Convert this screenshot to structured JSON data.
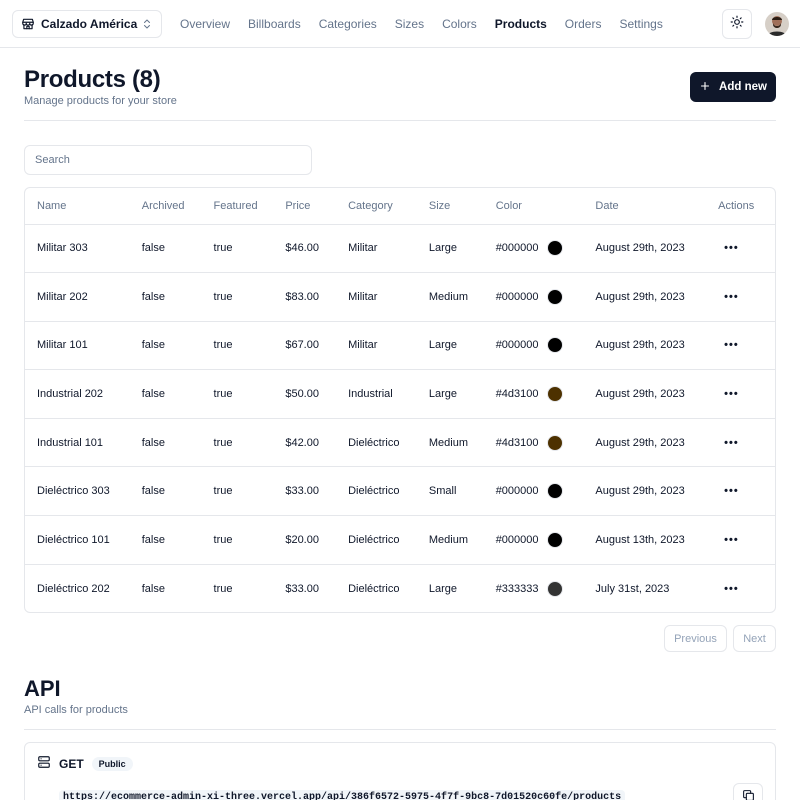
{
  "navbar": {
    "store_name": "Calzado América",
    "links": [
      {
        "label": "Overview",
        "active": false
      },
      {
        "label": "Billboards",
        "active": false
      },
      {
        "label": "Categories",
        "active": false
      },
      {
        "label": "Sizes",
        "active": false
      },
      {
        "label": "Colors",
        "active": false
      },
      {
        "label": "Products",
        "active": true
      },
      {
        "label": "Orders",
        "active": false
      },
      {
        "label": "Settings",
        "active": false
      }
    ],
    "icons": {
      "store": "store-icon",
      "switcher": "chevrons-up-down-icon",
      "theme": "sun-icon",
      "avatar": "avatar"
    }
  },
  "header": {
    "title": "Products (8)",
    "subtitle": "Manage products for your store",
    "add_label": "Add new"
  },
  "search": {
    "placeholder": "Search",
    "value": ""
  },
  "table": {
    "columns": [
      "Name",
      "Archived",
      "Featured",
      "Price",
      "Category",
      "Size",
      "Color",
      "Date",
      "Actions"
    ],
    "rows": [
      {
        "name": "Militar 303",
        "archived": "false",
        "featured": "true",
        "price": "$46.00",
        "category": "Militar",
        "size": "Large",
        "color": "#000000",
        "date": "August 29th, 2023"
      },
      {
        "name": "Militar 202",
        "archived": "false",
        "featured": "true",
        "price": "$83.00",
        "category": "Militar",
        "size": "Medium",
        "color": "#000000",
        "date": "August 29th, 2023"
      },
      {
        "name": "Militar 101",
        "archived": "false",
        "featured": "true",
        "price": "$67.00",
        "category": "Militar",
        "size": "Large",
        "color": "#000000",
        "date": "August 29th, 2023"
      },
      {
        "name": "Industrial 202",
        "archived": "false",
        "featured": "true",
        "price": "$50.00",
        "category": "Industrial",
        "size": "Large",
        "color": "#4d3100",
        "date": "August 29th, 2023"
      },
      {
        "name": "Industrial 101",
        "archived": "false",
        "featured": "true",
        "price": "$42.00",
        "category": "Dieléctrico",
        "size": "Medium",
        "color": "#4d3100",
        "date": "August 29th, 2023"
      },
      {
        "name": "Dieléctrico 303",
        "archived": "false",
        "featured": "true",
        "price": "$33.00",
        "category": "Dieléctrico",
        "size": "Small",
        "color": "#000000",
        "date": "August 29th, 2023"
      },
      {
        "name": "Dieléctrico 101",
        "archived": "false",
        "featured": "true",
        "price": "$20.00",
        "category": "Dieléctrico",
        "size": "Medium",
        "color": "#000000",
        "date": "August 13th, 2023"
      },
      {
        "name": "Dieléctrico 202",
        "archived": "false",
        "featured": "true",
        "price": "$33.00",
        "category": "Dieléctrico",
        "size": "Large",
        "color": "#333333",
        "date": "July 31st, 2023"
      }
    ],
    "actions_label": "•••"
  },
  "pagination": {
    "previous": "Previous",
    "next": "Next"
  },
  "api": {
    "title": "API",
    "subtitle": "API calls for products",
    "method": "GET",
    "badge": "Public",
    "url": "https://ecommerce-admin-xi-three.vercel.app/api/386f6572-5975-4f7f-9bc8-7d01520c60fe/products"
  },
  "colors": {
    "primary": "#0f172a",
    "muted": "#64748b",
    "border": "#e5e7eb"
  }
}
